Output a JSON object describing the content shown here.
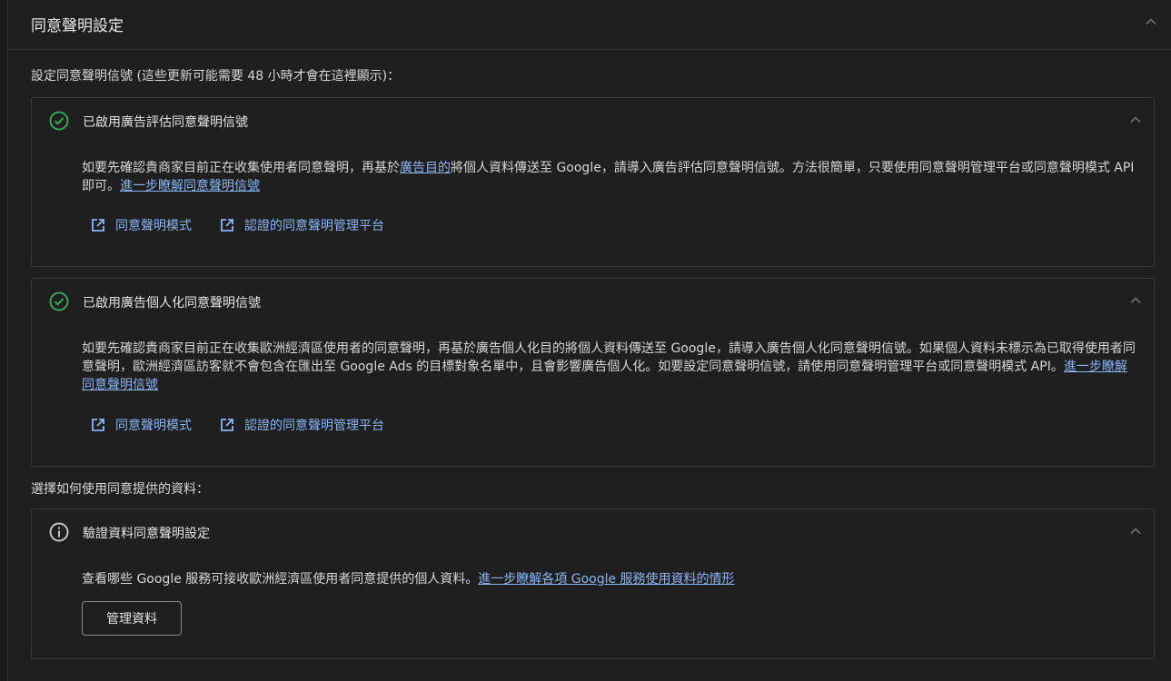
{
  "panel": {
    "title": "同意聲明設定"
  },
  "intro": "設定同意聲明信號 (這些更新可能需要 48 小時才會在這裡顯示)：",
  "cards": [
    {
      "title": "已啟用廣告評估同意聲明信號",
      "body_parts": [
        "如要先確認貴商家目前正在收集使用者同意聲明，再基於",
        "廣告目的",
        "將個人資料傳送至 Google，請導入廣告評估同意聲明信號。方法很簡單，只要使用同意聲明管理平台或同意聲明模式 API 即可。",
        "進一步瞭解同意聲明信號"
      ],
      "links": [
        "同意聲明模式",
        "認證的同意聲明管理平台"
      ]
    },
    {
      "title": "已啟用廣告個人化同意聲明信號",
      "body_parts": [
        "如要先確認貴商家目前正在收集歐洲經濟區使用者的同意聲明，再基於廣告個人化目的將個人資料傳送至 Google，請導入廣告個人化同意聲明信號。如果個人資料未標示為已取得使用者同意聲明，歐洲經濟區訪客就不會包含在匯出至 Google Ads 的目標對象名單中，且會影響廣告個人化。如要設定同意聲明信號，請使用同意聲明管理平台或同意聲明模式 API。",
        "進一步瞭解同意聲明信號"
      ],
      "links": [
        "同意聲明模式",
        "認證的同意聲明管理平台"
      ]
    }
  ],
  "data_section_label": "選擇如何使用同意提供的資料：",
  "verify_card": {
    "title": "驗證資料同意聲明設定",
    "body_text": "查看哪些 Google 服務可接收歐洲經濟區使用者同意提供的個人資料。",
    "body_link": "進一步瞭解各項 Google 服務使用資料的情形",
    "button_label": "管理資料"
  },
  "colors": {
    "background": "#1f1f1f",
    "success": "#34a853",
    "link": "#8ab4f8"
  },
  "icons": {
    "card_status": "check-circle-icon",
    "info": "info-icon",
    "external_link": "open-in-new-icon",
    "collapse": "chevron-up-icon"
  }
}
